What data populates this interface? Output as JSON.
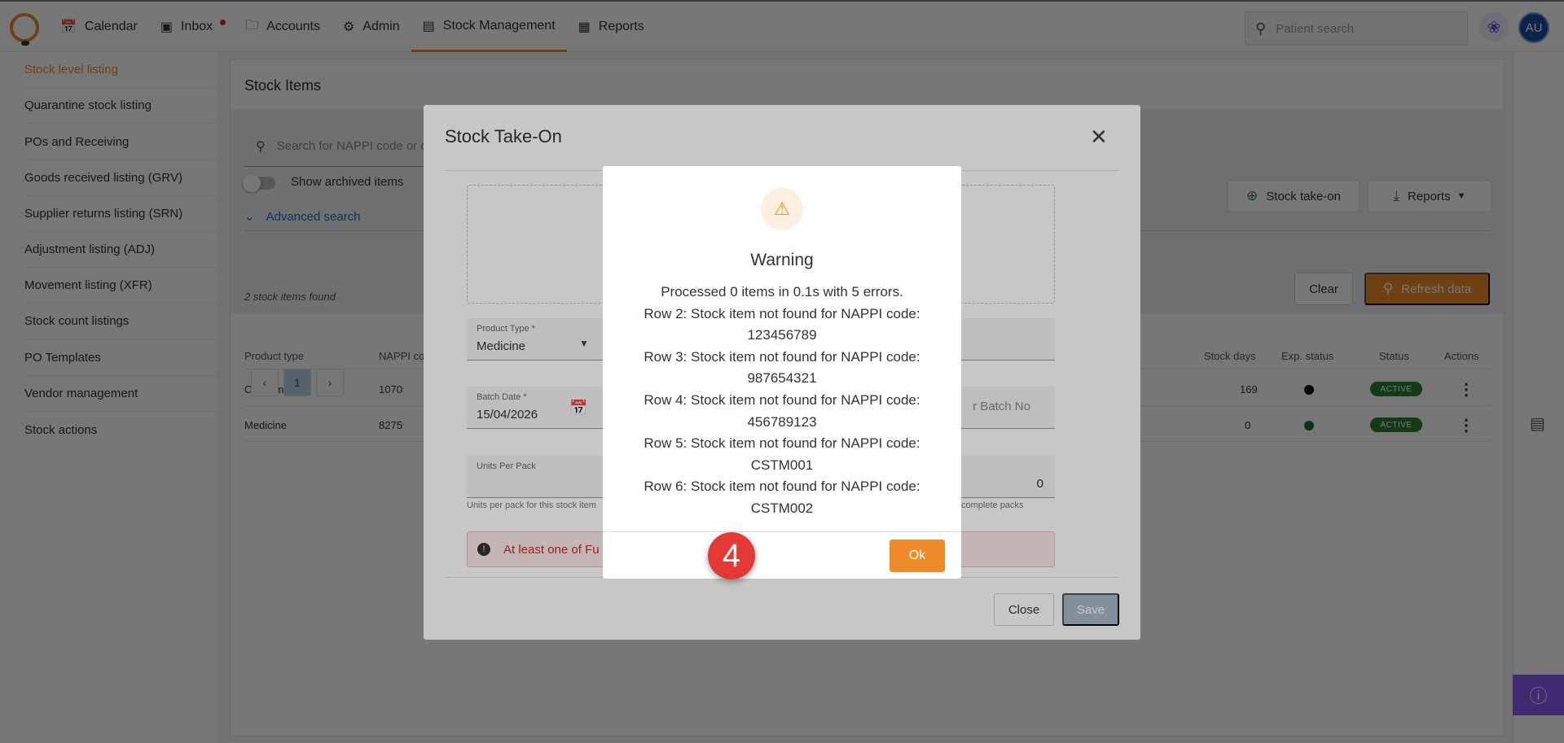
{
  "nav": {
    "items": [
      {
        "label": "Calendar",
        "icon": "calendar-icon"
      },
      {
        "label": "Inbox",
        "icon": "inbox-icon"
      },
      {
        "label": "Accounts",
        "icon": "folder-icon"
      },
      {
        "label": "Admin",
        "icon": "admin-icon"
      },
      {
        "label": "Stock Management",
        "icon": "stock-icon"
      },
      {
        "label": "Reports",
        "icon": "reports-icon"
      }
    ],
    "active": "Stock Management",
    "search_placeholder": "Patient search",
    "avatar_initials": "AU"
  },
  "sidebar": {
    "items": [
      "Stock level listing",
      "Quarantine stock listing",
      "POs and Receiving",
      "Goods received listing (GRV)",
      "Supplier returns listing (SRN)",
      "Adjustment listing (ADJ)",
      "Movement listing (XFR)",
      "Stock count listings",
      "PO Templates",
      "Vendor management",
      "Stock actions"
    ],
    "active": "Stock level listing"
  },
  "main": {
    "title": "Stock Items",
    "search_placeholder": "Search for NAPPI code or d",
    "toggle_label": "Show archived items",
    "advanced_search": "Advanced search",
    "items_found": "2 stock items found",
    "stock_take_on_button": "Stock take-on",
    "reports_button": "Reports",
    "clear_button": "Clear",
    "refresh_button": "Refresh data",
    "columns": [
      "Product type",
      "NAPPI co",
      "Stock days",
      "Exp. status",
      "Status",
      "Actions"
    ],
    "rows": [
      {
        "product_type": "Consumable",
        "nappi": "10705920",
        "stock_days": "169",
        "exp_color": "#000000",
        "status": "ACTIVE"
      },
      {
        "product_type": "Medicine",
        "nappi": "8275920",
        "stock_days": "0",
        "exp_color": "#1b6e2a",
        "status": "ACTIVE"
      }
    ],
    "pager": {
      "prev": "‹",
      "current": "1",
      "next": "›"
    }
  },
  "modal": {
    "title": "Stock Take-On",
    "product_type_label": "Product Type *",
    "product_type_value": "Medicine",
    "batch_date_label": "Batch Date *",
    "batch_date_value": "15/04/2026",
    "batch_no_placeholder": "r Batch No",
    "units_label": "Units Per Pack",
    "units_hint": "Units per pack for this stock item",
    "packs_value": "0",
    "packs_hint": "complete packs",
    "error_text": "At least one of Fu",
    "close_button": "Close",
    "save_button": "Save"
  },
  "warning": {
    "title": "Warning",
    "lines": [
      "Processed 0 items in 0.1s with 5 errors.",
      "Row 2: Stock item not found for NAPPI code:",
      "123456789",
      "Row 3: Stock item not found for NAPPI code:",
      "987654321",
      "Row 4: Stock item not found for NAPPI code:",
      "456789123",
      "Row 5: Stock item not found for NAPPI code:",
      "CSTM001",
      "Row 6: Stock item not found for NAPPI code:",
      "CSTM002"
    ],
    "ok_button": "Ok"
  },
  "step_marker": "4",
  "colors": {
    "accent": "#ef8a2b",
    "active_badge": "#2e7d32",
    "link": "#1a6fbf",
    "error": "#c62828"
  }
}
